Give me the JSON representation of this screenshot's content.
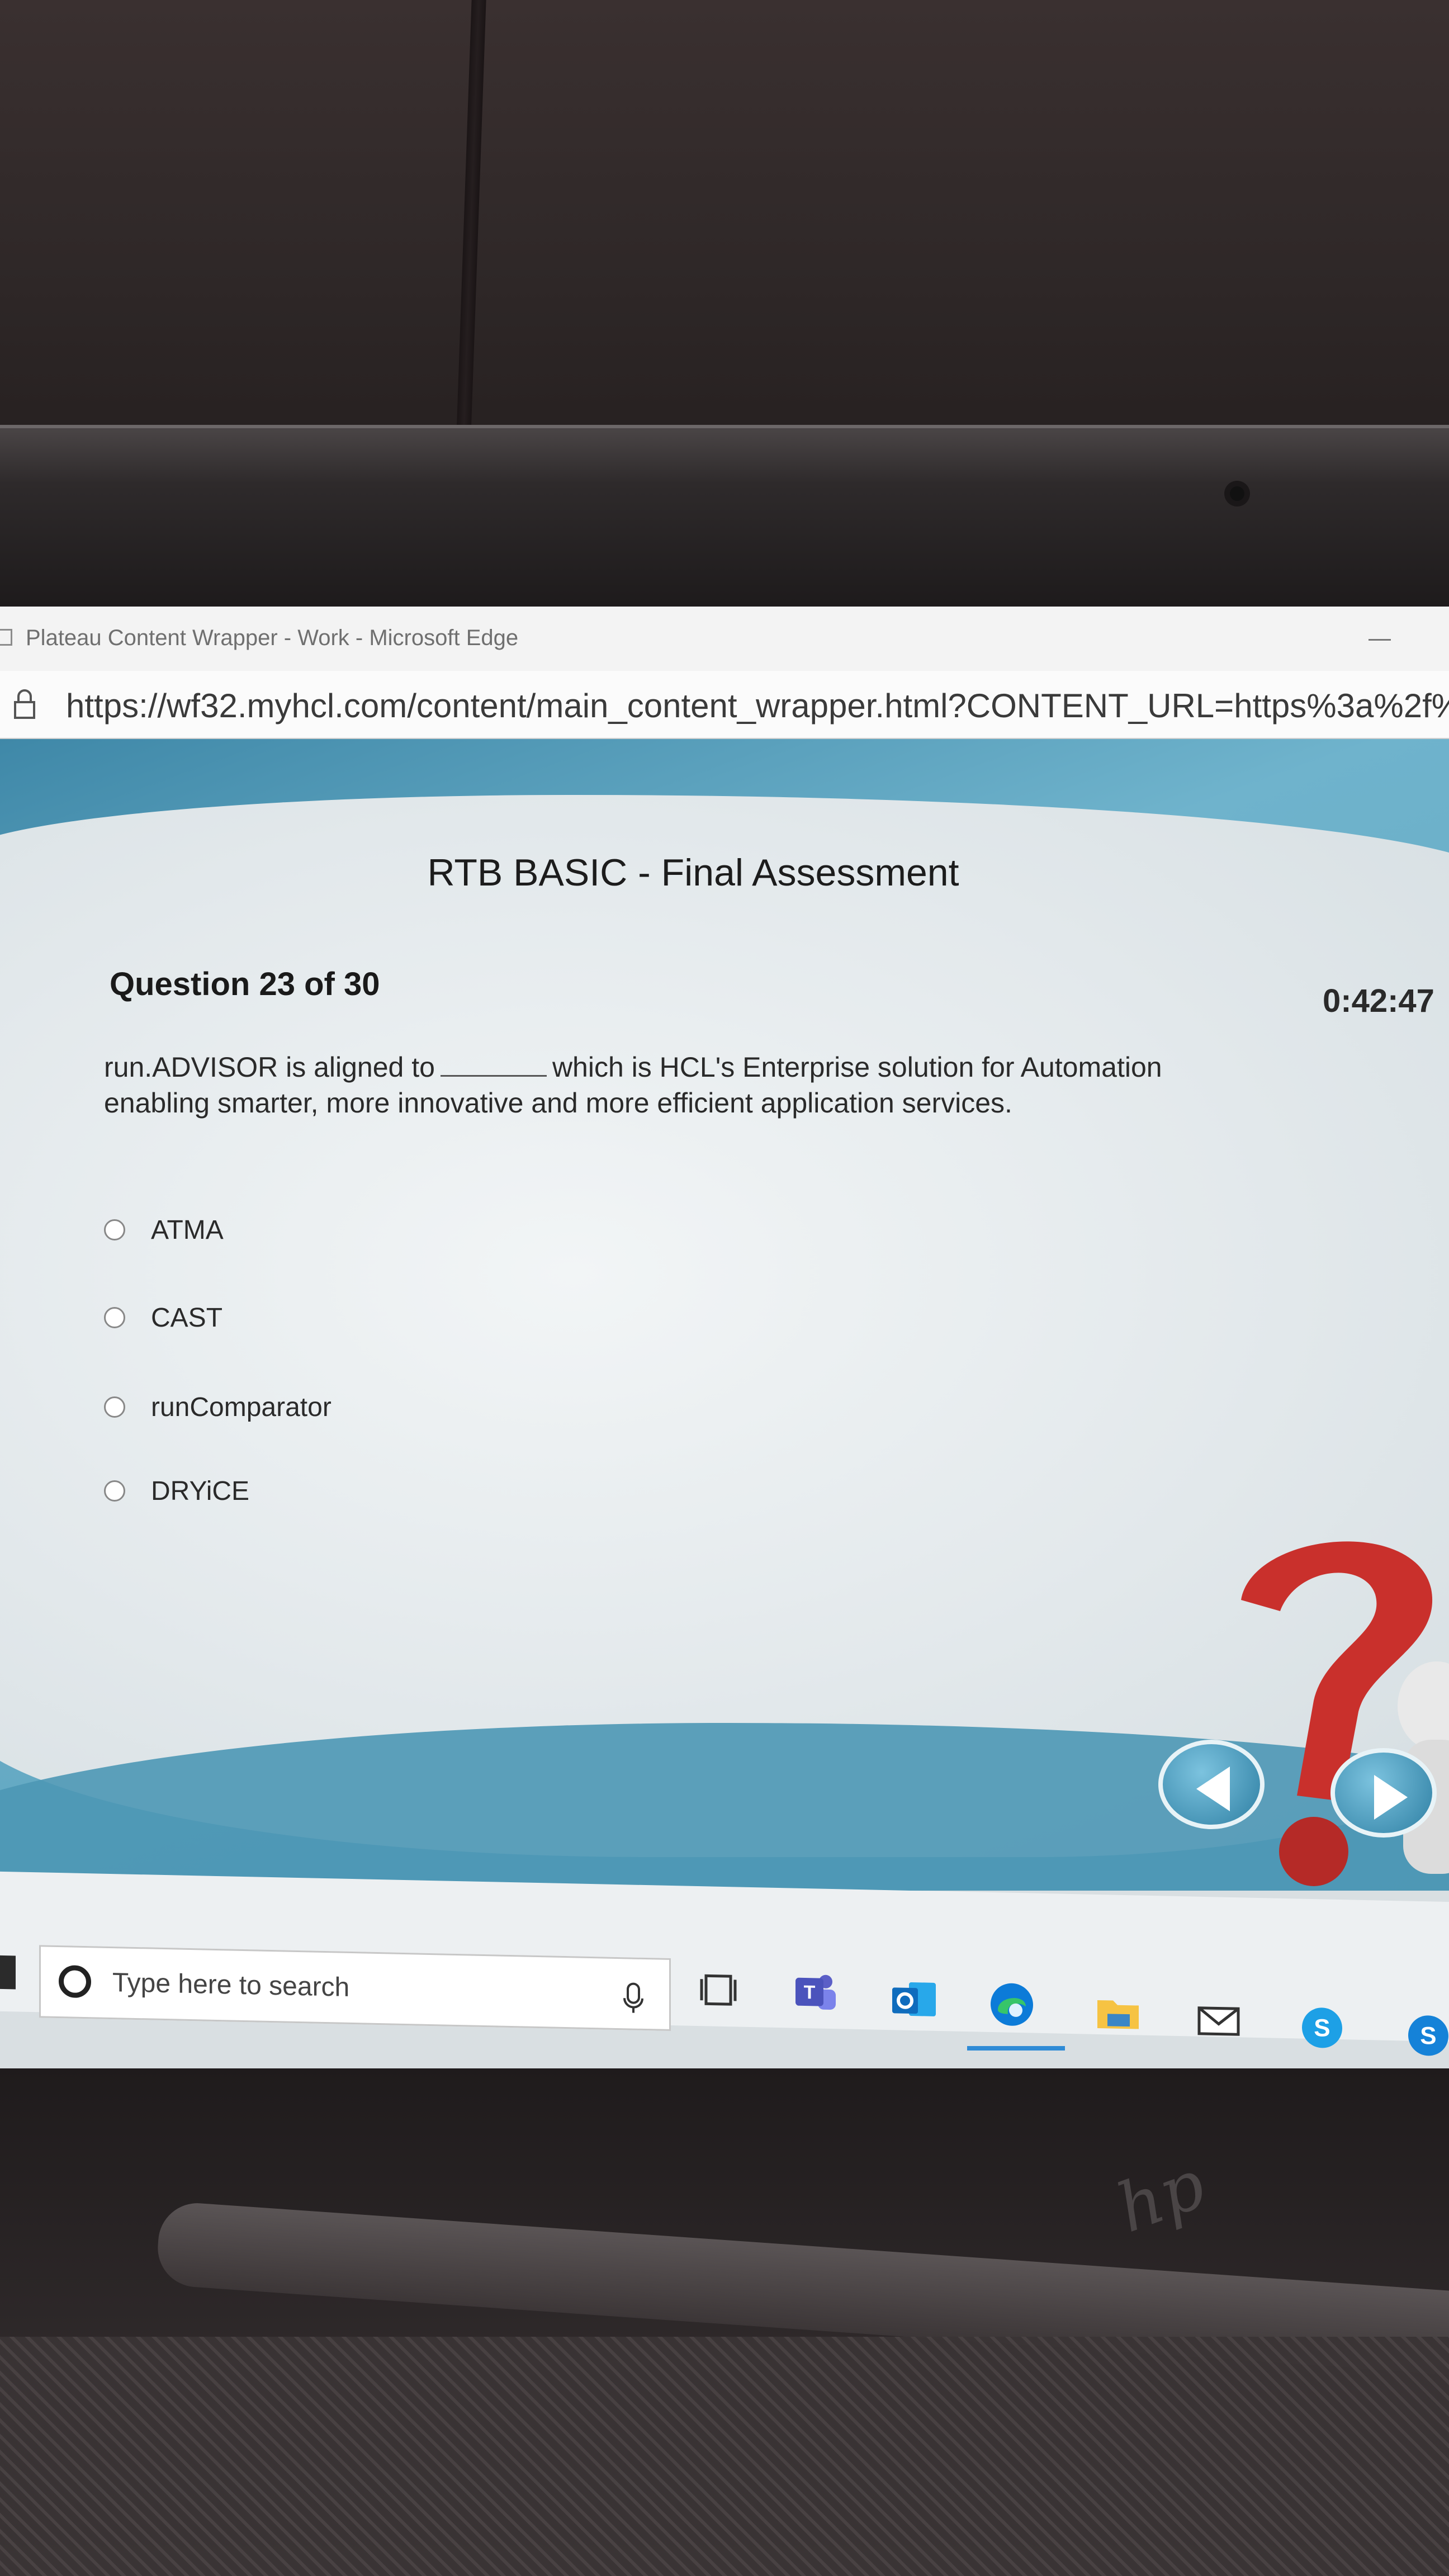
{
  "browser": {
    "window_title": "Plateau Content Wrapper - Work - Microsoft Edge",
    "url": "https://wf32.myhcl.com/content/main_content_wrapper.html?CONTENT_URL=https%3a%2f%2fw"
  },
  "assessment": {
    "title": "RTB BASIC - Final Assessment",
    "question_number": "Question 23 of 30",
    "timer": "0:42:47",
    "question_part1": "run.ADVISOR is aligned to",
    "question_part2": "which is HCL's Enterprise solution for Automation enabling smarter, more innovative and more efficient application services.",
    "options": [
      "ATMA",
      "CAST",
      "runComparator",
      "DRYiCE"
    ]
  },
  "taskbar": {
    "search_placeholder": "Type here to search",
    "icons": [
      "windows-start-icon",
      "search-icon",
      "microphone-icon",
      "task-view-icon",
      "teams-icon",
      "outlook-icon",
      "edge-icon",
      "file-explorer-icon",
      "mail-icon",
      "skype-icon",
      "skype-for-business-icon"
    ]
  },
  "colors": {
    "accent_blue": "#3f88a8",
    "card_bg": "#e6ecef",
    "question_mark_red": "#c9302c"
  }
}
